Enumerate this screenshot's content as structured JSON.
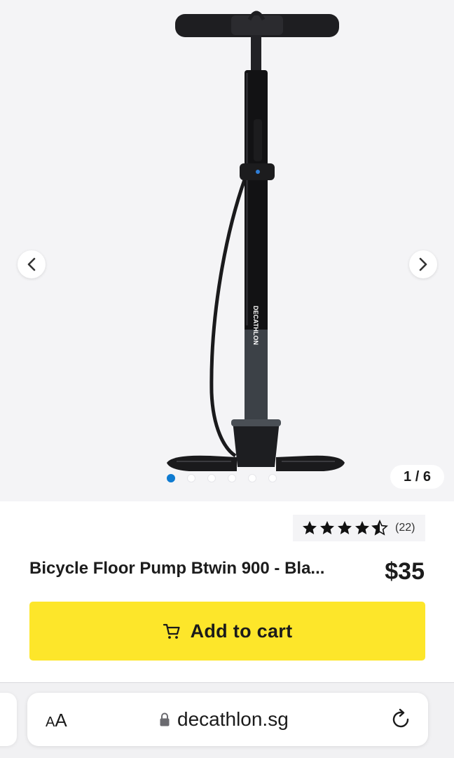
{
  "gallery": {
    "counter": "1 / 6",
    "current_image": 1,
    "total_images": 6,
    "active_dot_color": "#0f7bd1",
    "prev_icon": "chevron-left-icon",
    "next_icon": "chevron-right-icon"
  },
  "product": {
    "rating_value": 4.5,
    "rating_max": 5,
    "review_count": "(22)",
    "title": "Bicycle Floor Pump Btwin 900 - Bla...",
    "price": "$35",
    "pump_brand_text": "DECATHLON"
  },
  "cart_button": {
    "label": "Add to cart",
    "icon": "cart-icon",
    "color": "#fde62a"
  },
  "browser": {
    "text_size_label_small": "A",
    "text_size_label_large": "A",
    "lock_icon": "lock-icon",
    "url": "decathlon.sg",
    "reload_icon": "reload-icon"
  }
}
